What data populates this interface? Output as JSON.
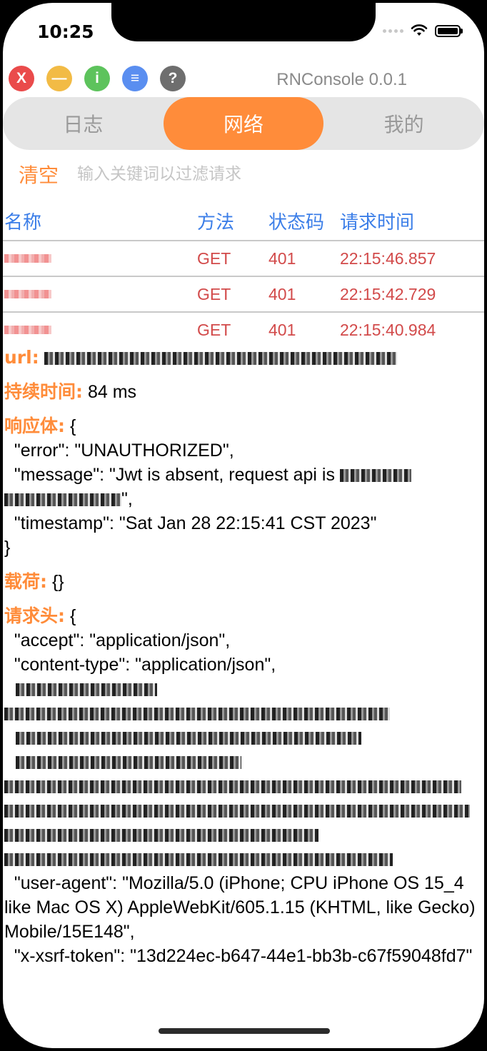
{
  "status": {
    "time": "10:25"
  },
  "toolbar": {
    "buttons": [
      {
        "label": "X",
        "color": "#ea4b4b",
        "name": "close-button"
      },
      {
        "label": "—",
        "color": "#f2bb45",
        "name": "minimize-button"
      },
      {
        "label": "i",
        "color": "#5dc35c",
        "name": "info-button"
      },
      {
        "label": "≡",
        "color": "#5a8ef0",
        "name": "menu-button"
      },
      {
        "label": "?",
        "color": "#6e6e6e",
        "name": "help-button"
      }
    ],
    "title": "RNConsole 0.0.1"
  },
  "tabs": [
    {
      "label": "日志",
      "active": false
    },
    {
      "label": "网络",
      "active": true
    },
    {
      "label": "我的",
      "active": false
    }
  ],
  "filter": {
    "clear_label": "清空",
    "placeholder": "输入关键词以过滤请求"
  },
  "table": {
    "headers": {
      "name": "名称",
      "method": "方法",
      "status": "状态码",
      "time": "请求时间"
    },
    "rows": [
      {
        "method": "GET",
        "status": "401",
        "time": "22:15:46.857"
      },
      {
        "method": "GET",
        "status": "401",
        "time": "22:15:42.729"
      },
      {
        "method": "GET",
        "status": "401",
        "time": "22:15:40.984"
      }
    ]
  },
  "detail": {
    "url_label": "url:",
    "duration_label": "持续时间:",
    "duration_value": "84 ms",
    "response_label": "响应体:",
    "response_open": "{",
    "response_lines": [
      "  \"error\": \"UNAUTHORIZED\",",
      "  \"message\": \"Jwt is absent, request api is ",
      "  \"timestamp\": \"Sat Jan 28 22:15:41 CST 2023\"",
      "}"
    ],
    "response_message_tail": "\",",
    "payload_label": "载荷:",
    "payload_value": "{}",
    "headers_label": "请求头:",
    "headers_open": "{",
    "headers_lines_top": [
      "  \"accept\": \"application/json\",",
      "  \"content-type\": \"application/json\","
    ],
    "headers_lines_bottom": [
      "  \"user-agent\": \"Mozilla/5.0 (iPhone; CPU iPhone OS 15_4 like Mac OS X) AppleWebKit/605.1.15 (KHTML, like Gecko) Mobile/15E148\",",
      "  \"x-xsrf-token\": \"13d224ec-b647-44e1-bb3b-c67f59048fd7\""
    ]
  }
}
